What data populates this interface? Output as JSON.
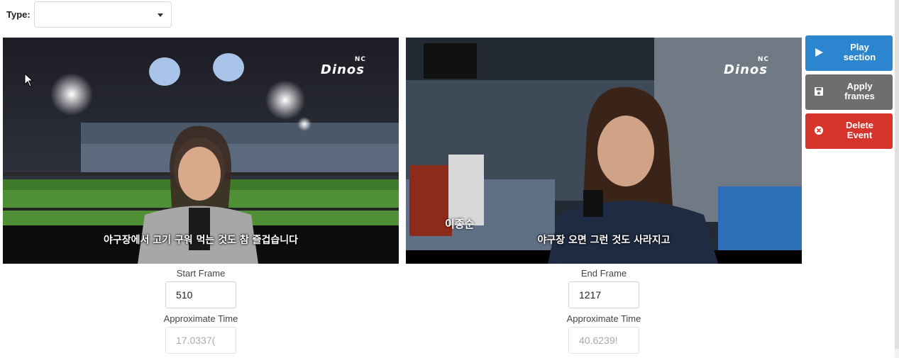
{
  "toolbar": {
    "type_label": "Type:",
    "type_value": ""
  },
  "left_video": {
    "logo": "Dinos",
    "logo_small": "NC",
    "subtitle": "야구장에서 고기 구워 먹는 것도 참 즐겁습니다"
  },
  "right_video": {
    "logo": "Dinos",
    "logo_small": "NC",
    "speaker": "이종순",
    "subtitle": "야구장 오면 그런 것도 사라지고"
  },
  "start": {
    "frame_label": "Start Frame",
    "frame_value": "510",
    "time_label": "Approximate Time",
    "time_value": "17.0337("
  },
  "end": {
    "frame_label": "End Frame",
    "frame_value": "1217",
    "time_label": "Approximate Time",
    "time_value": "40.6239!"
  },
  "actions": {
    "play": {
      "line1": "Play",
      "line2": "section",
      "icon": "play-icon",
      "color": "#2b86cf"
    },
    "apply": {
      "line1": "Apply",
      "line2": "frames",
      "icon": "save-icon",
      "color": "#6e6e6e"
    },
    "delete": {
      "line1": "Delete",
      "line2": "Event",
      "icon": "close-circle-icon",
      "color": "#d6332b"
    }
  }
}
